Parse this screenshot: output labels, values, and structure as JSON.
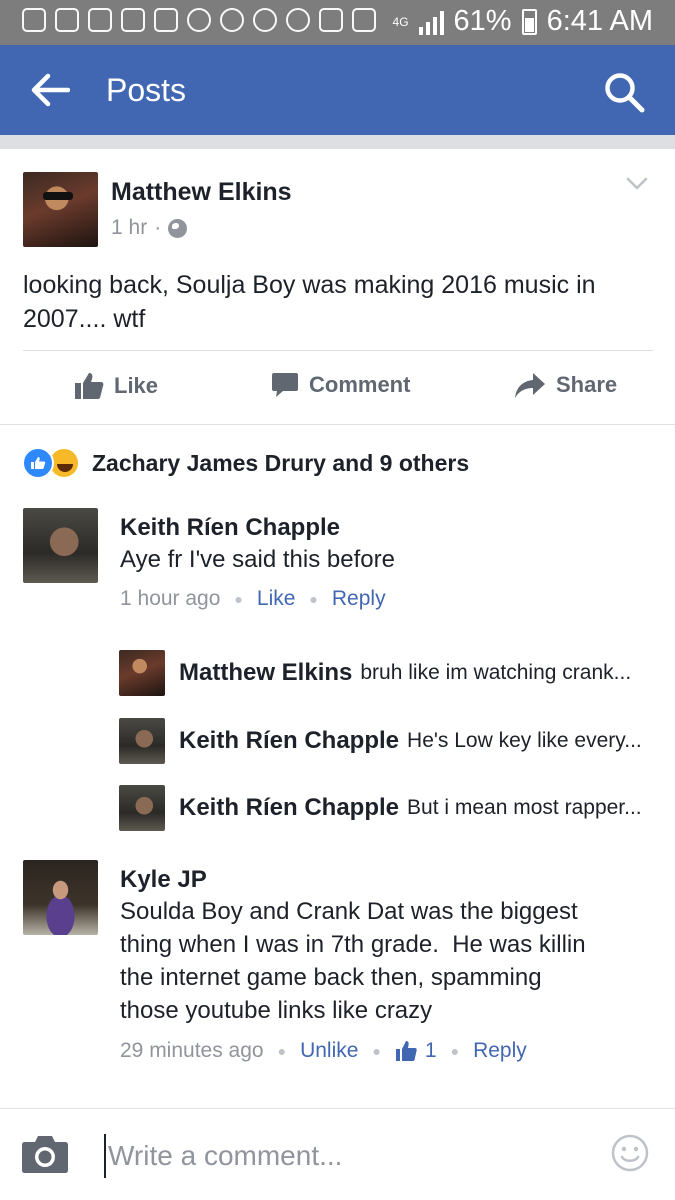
{
  "status_bar": {
    "battery": "61%",
    "time": "6:41 AM",
    "network": "4G"
  },
  "app_bar": {
    "title": "Posts",
    "back_icon": "arrow-left-icon",
    "search_icon": "search-icon",
    "color": "#4267b2"
  },
  "post": {
    "author": "Matthew Elkins",
    "time": "1 hr",
    "privacy_icon": "globe-icon",
    "text": "looking back, Soulja Boy was making 2016 music in 2007.... wtf",
    "actions": {
      "like": "Like",
      "comment": "Comment",
      "share": "Share"
    }
  },
  "reactions": {
    "summary": "Zachary James Drury and 9 others",
    "types": [
      "like",
      "haha"
    ]
  },
  "comments": [
    {
      "author": "Keith Ríen Chapple",
      "text": "Aye fr I've said this before",
      "time": "1 hour ago",
      "like_label": "Like",
      "reply_label": "Reply",
      "replies": [
        {
          "author": "Matthew Elkins",
          "text": "bruh like im watching crank..."
        },
        {
          "author": "Keith Ríen Chapple",
          "text": "He's Low key like every..."
        },
        {
          "author": "Keith Ríen Chapple",
          "text": "But i mean most rapper..."
        }
      ]
    },
    {
      "author": "Kyle JP",
      "text_lines": [
        "Soulda Boy and Crank Dat was the biggest",
        "thing when I was in 7th grade.  He was killin",
        "the internet game back then, spamming",
        "those youtube links like crazy"
      ],
      "time": "29 minutes ago",
      "like_label": "Unlike",
      "like_count": "1",
      "reply_label": "Reply"
    }
  ],
  "composer": {
    "placeholder": "Write a comment...",
    "camera_icon": "camera-icon",
    "emoji_icon": "smiley-icon"
  },
  "colors": {
    "brand": "#4267b2",
    "link": "#4267b2",
    "muted": "#90949c",
    "status_bar": "#7d7d7d"
  }
}
